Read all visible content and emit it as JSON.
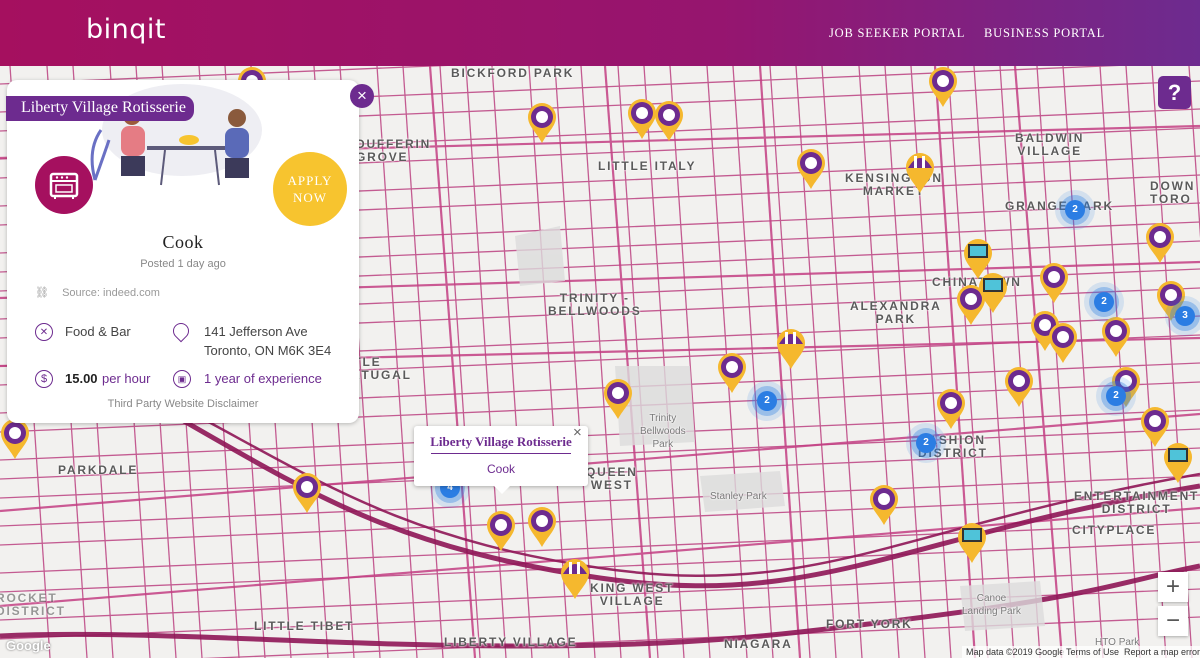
{
  "header": {
    "logo": "binqit",
    "nav": [
      "JOB SEEKER PORTAL",
      "BUSINESS PORTAL"
    ]
  },
  "map_labels": [
    {
      "text": "BICKFORD PARK"
    },
    {
      "text": "LITTLE ITALY"
    },
    {
      "text": "DUFFERIN\nGROVE"
    },
    {
      "text": "KENSINGTON\nMARKET"
    },
    {
      "text": "BALDWIN\nVILLAGE"
    },
    {
      "text": "GRANGE PARK"
    },
    {
      "text": "DOWN\nTORO"
    },
    {
      "text": "CHINATOWN"
    },
    {
      "text": "TRINITY -\nBELLWOODS"
    },
    {
      "text": "ALEXANDRA\nPARK"
    },
    {
      "text": "LITTLE\nPORTUGAL"
    },
    {
      "text": "PARKDALE"
    },
    {
      "text": "QUEEN\nWEST"
    },
    {
      "text": "FASHION\nDISTRICT"
    },
    {
      "text": "ENTERTAINMENT\nDISTRICT"
    },
    {
      "text": "CITYPLACE"
    },
    {
      "text": "KING WEST\nVILLAGE"
    },
    {
      "text": "LITTLE TIBET"
    },
    {
      "text": "LIBERTY VILLAGE"
    },
    {
      "text": "NIAGARA"
    },
    {
      "text": "FORT YORK"
    },
    {
      "text": "ROCKET\nDISTRICT"
    },
    {
      "text": "Trinity\nBellwoods\nPark"
    },
    {
      "text": "Stanley Park"
    },
    {
      "text": "Canoe\nLanding Park"
    },
    {
      "text": "HTO Park"
    }
  ],
  "clusters": [
    "2",
    "2",
    "3",
    "2",
    "2",
    "2",
    "4"
  ],
  "card": {
    "company": "Liberty Village Rotisserie",
    "close": "×",
    "apply": "APPLY NOW",
    "title": "Cook",
    "posted": "Posted 1 day ago",
    "source": "Source: indeed.com",
    "category": "Food & Bar",
    "address_line1": "141 Jefferson Ave",
    "address_line2": "Toronto, ON M6K 3E4",
    "wage_amount": "15.00",
    "wage_unit": "per hour",
    "experience": "1 year of experience",
    "disclaimer": "Third Party Website Disclaimer"
  },
  "bubble": {
    "company": "Liberty Village Rotisserie",
    "title": "Cook",
    "close": "×"
  },
  "controls": {
    "help": "?",
    "zoom_in": "+",
    "zoom_out": "−"
  },
  "footer": {
    "brand": "Google",
    "map_data": "Map data ©2019 Google",
    "terms": "Terms of Use",
    "report": "Report a map error"
  },
  "colors": {
    "brand_magenta": "#a5105f",
    "brand_purple": "#6d2b8f",
    "apply_yellow": "#f7c42f",
    "pin_yellow": "#f5b82e",
    "cluster_blue": "#2b7de3",
    "road": "#a3155c"
  }
}
